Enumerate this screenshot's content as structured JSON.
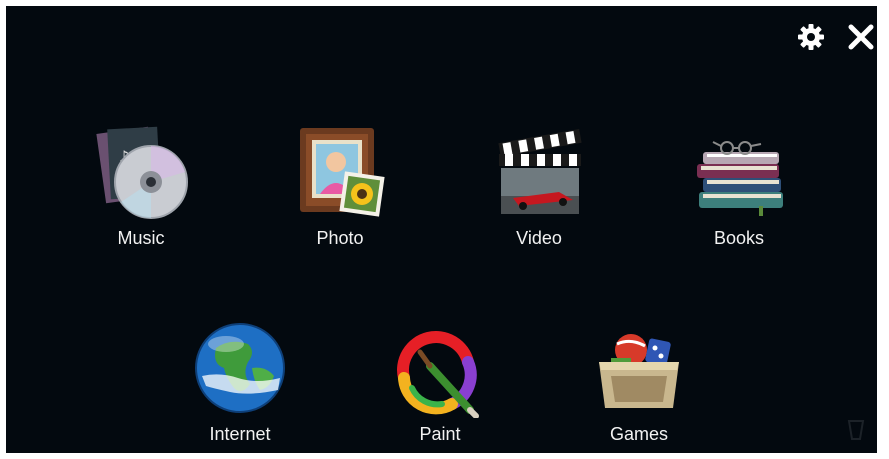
{
  "toolbar": {
    "settings_icon": "gear-icon",
    "close_icon": "close-icon"
  },
  "apps": [
    {
      "label": "Music",
      "icon": "music-disc-icon"
    },
    {
      "label": "Photo",
      "icon": "photo-frame-icon"
    },
    {
      "label": "Video",
      "icon": "video-clapperboard-icon"
    },
    {
      "label": "Books",
      "icon": "books-stack-icon"
    },
    {
      "label": "Internet",
      "icon": "globe-icon"
    },
    {
      "label": "Paint",
      "icon": "paint-brush-icon"
    },
    {
      "label": "Games",
      "icon": "games-box-icon"
    }
  ],
  "colors": {
    "background": "#03090f",
    "label_text": "#f2f2f2"
  }
}
